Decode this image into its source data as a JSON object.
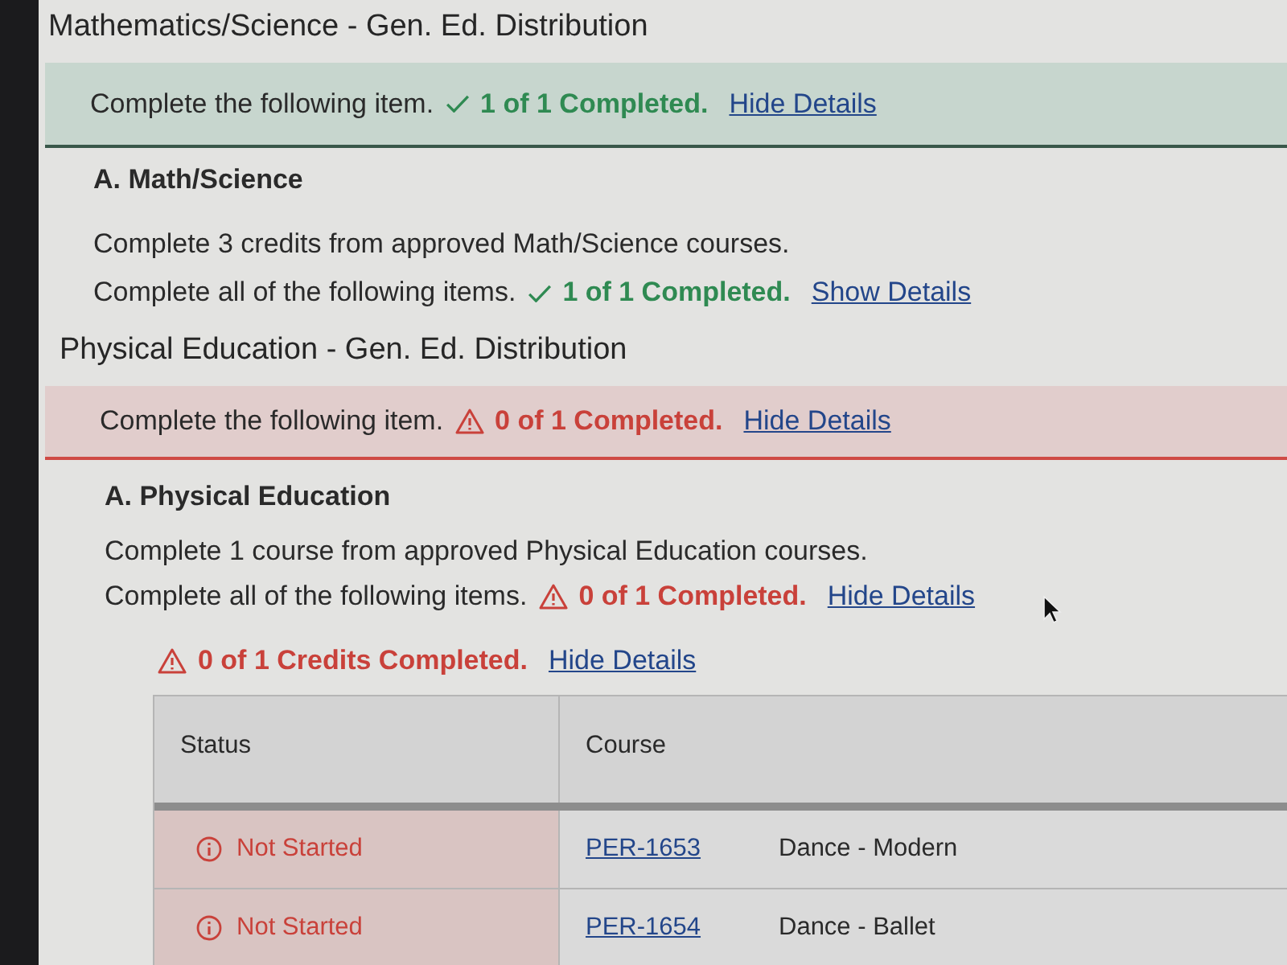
{
  "sections": [
    {
      "title": "Mathematics/Science - Gen. Ed. Distribution",
      "completed": true,
      "summary": {
        "text": "Complete the following item.",
        "count": "1 of 1 Completed.",
        "link": "Hide Details"
      },
      "requirements": [
        {
          "heading": "A. Math/Science",
          "description": "Complete 3 credits from approved Math/Science courses.",
          "items": {
            "text": "Complete all of the following items.",
            "completed": true,
            "count": "1 of 1 Completed.",
            "link": "Show Details"
          }
        }
      ]
    },
    {
      "title": "Physical Education - Gen. Ed. Distribution",
      "completed": false,
      "summary": {
        "text": "Complete the following item.",
        "count": "0 of 1 Completed.",
        "link": "Hide Details"
      },
      "requirements": [
        {
          "heading": "A. Physical Education",
          "description": "Complete 1 course from approved Physical Education courses.",
          "items": {
            "text": "Complete all of the following items.",
            "completed": false,
            "count": "0 of 1 Completed.",
            "link": "Hide Details"
          },
          "credits": {
            "completed": false,
            "count": "0 of 1 Credits Completed.",
            "link": "Hide Details"
          },
          "table": {
            "columns": [
              "Status",
              "Course"
            ],
            "rows": [
              {
                "status": "Not Started",
                "completed": false,
                "code": "PER-1653",
                "title": "Dance - Modern"
              },
              {
                "status": "Not Started",
                "completed": false,
                "code": "PER-1654",
                "title": "Dance - Ballet"
              }
            ]
          }
        }
      ]
    }
  ]
}
